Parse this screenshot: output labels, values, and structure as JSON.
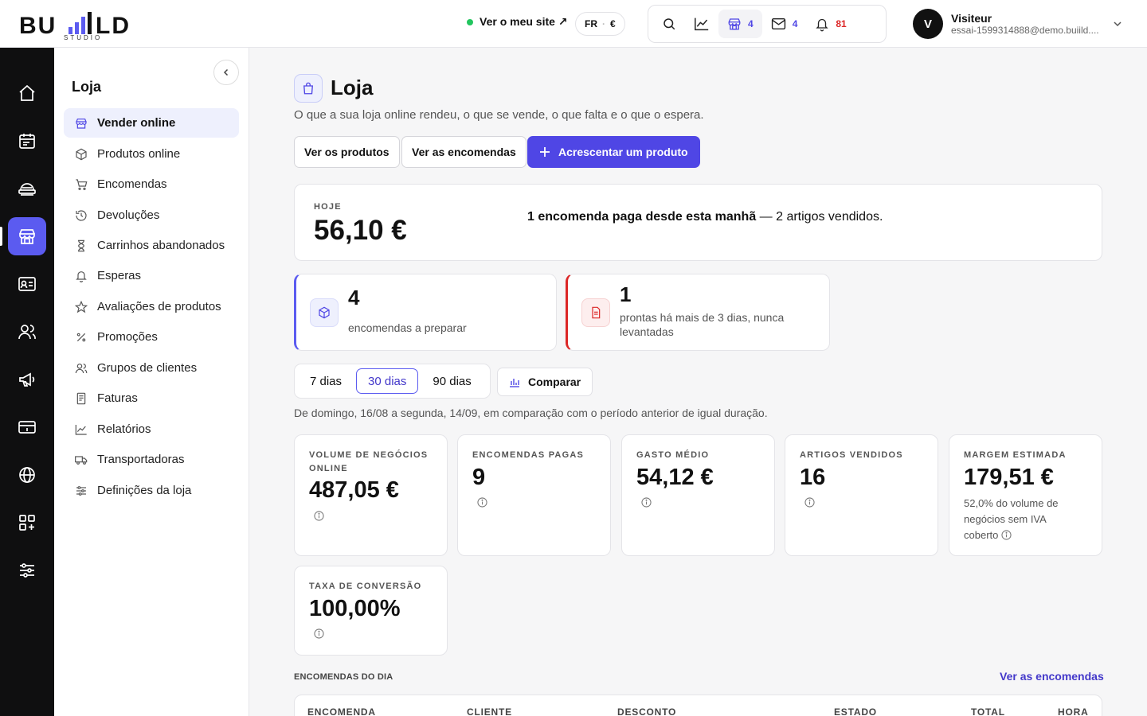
{
  "brand": {
    "logo_text": "BU▮LD",
    "logo_sub": "STUDIO"
  },
  "topbar": {
    "site_link": "Ver o meu site ↗",
    "lang": "FR",
    "currency": "€",
    "shop_count": "4",
    "mail_count": "4",
    "notif_count": "81",
    "user_initial": "V",
    "user_name": "Visiteur",
    "user_email": "essai-1599314888@demo.buiild...."
  },
  "subnav": {
    "title": "Loja",
    "items": [
      {
        "label": "Vender online",
        "icon": "storefront-icon"
      },
      {
        "label": "Produtos online",
        "icon": "cube-icon"
      },
      {
        "label": "Encomendas",
        "icon": "cart-icon"
      },
      {
        "label": "Devoluções",
        "icon": "return-icon"
      },
      {
        "label": "Carrinhos abandonados",
        "icon": "hourglass-icon"
      },
      {
        "label": "Esperas",
        "icon": "bell-icon"
      },
      {
        "label": "Avaliações de produtos",
        "icon": "star-icon"
      },
      {
        "label": "Promoções",
        "icon": "percent-icon"
      },
      {
        "label": "Grupos de clientes",
        "icon": "users-icon"
      },
      {
        "label": "Faturas",
        "icon": "invoice-icon"
      },
      {
        "label": "Relatórios",
        "icon": "chart-icon"
      },
      {
        "label": "Transportadoras",
        "icon": "truck-icon"
      },
      {
        "label": "Definições da loja",
        "icon": "sliders-icon"
      }
    ]
  },
  "page": {
    "title": "Loja",
    "subtitle": "O que a sua loja online rendeu, o que se vende, o que falta e o que o espera.",
    "btn_products": "Ver os produtos",
    "btn_orders": "Ver as encomendas",
    "btn_add": "Acrescentar um produto"
  },
  "today": {
    "label": "HOJE",
    "value": "56,10 €",
    "summary_bold": "1 encomenda paga desde esta manhã",
    "summary_rest": " — 2 artigos vendidos."
  },
  "alerts": {
    "prepare_num": "4",
    "prepare_text": "encomendas a preparar",
    "pickup_num": "1",
    "pickup_text": "prontas há mais de 3 dias, nunca levantadas"
  },
  "ranges": {
    "r7": "7 dias",
    "r30": "30 dias",
    "r90": "90 dias",
    "compare": "Comparar"
  },
  "period_note": "De domingo, 16/08 a segunda, 14/09, em comparação com o período anterior de igual duração.",
  "kpis": {
    "volume_label": "VOLUME DE NEGÓCIOS ONLINE",
    "volume_value": "487,05 €",
    "orders_label": "ENCOMENDAS PAGAS",
    "orders_value": "9",
    "avg_label": "GASTO MÉDIO",
    "avg_value": "54,12 €",
    "items_label": "ARTIGOS VENDIDOS",
    "items_value": "16",
    "margin_label": "MARGEM ESTIMADA",
    "margin_value": "179,51 €",
    "margin_note": "52,0% do volume de negócios sem IVA coberto",
    "conv_label": "TAXA DE CONVERSÃO",
    "conv_value": "100,00%"
  },
  "orders_table": {
    "section_label": "ENCOMENDAS DO DIA",
    "link": "Ver as encomendas",
    "columns": [
      "ENCOMENDA",
      "CLIENTE",
      "DESCONTO",
      "ESTADO",
      "TOTAL",
      "HORA"
    ]
  },
  "colors": {
    "accent": "#4f46e5",
    "alert_red": "#dc2626",
    "online_green": "#22c55e"
  }
}
